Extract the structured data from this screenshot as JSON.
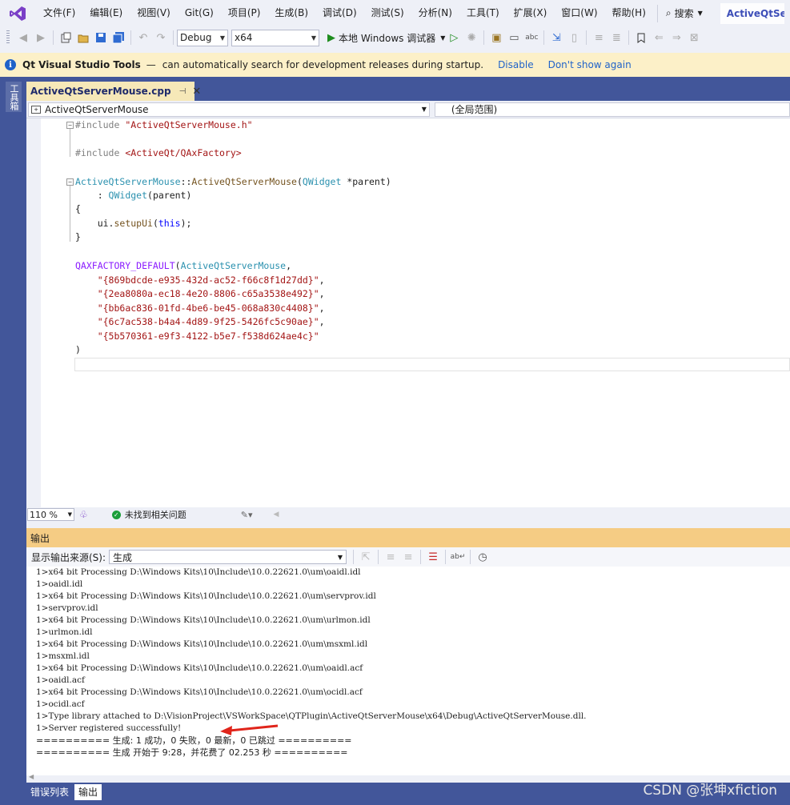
{
  "menu": {
    "items": [
      "文件(F)",
      "编辑(E)",
      "视图(V)",
      "Git(G)",
      "项目(P)",
      "生成(B)",
      "调试(D)",
      "测试(S)",
      "分析(N)",
      "工具(T)",
      "扩展(X)",
      "窗口(W)",
      "帮助(H)"
    ],
    "search_label": "搜索",
    "solution_name": "ActiveQtServerMouse"
  },
  "toolbar": {
    "configuration": "Debug",
    "platform": "x64",
    "run_label": "本地 Windows 调试器"
  },
  "infobar": {
    "title": "Qt Visual Studio Tools",
    "dash": "—",
    "message": "can automatically search for development releases during startup.",
    "link_disable": "Disable",
    "link_dont_show": "Don't show again"
  },
  "left_rail": {
    "toolbox_label": "工具箱"
  },
  "editor": {
    "tab_name": "ActiveQtServerMouse.cpp",
    "nav_class": "ActiveQtServerMouse",
    "nav_scope": "(全局范围)",
    "lines": [
      "#include \"ActiveQtServerMouse.h\"",
      "#include <ActiveQt/QAxFactory>",
      "ActiveQtServerMouse::ActiveQtServerMouse(QWidget *parent)",
      "    : QWidget(parent)",
      "{",
      "    ui.setupUi(this);",
      "}",
      "QAXFACTORY_DEFAULT(ActiveQtServerMouse,",
      "    \"{869bdcde-e935-432d-ac52-f66c8f1d27dd}\",",
      "    \"{2ea8080a-ec18-4e20-8806-c65a3538e492}\",",
      "    \"{bb6ac836-01fd-4be6-be45-068a830c4408}\",",
      "    \"{6c7ac538-b4a4-4d89-9f25-5426fc5c90ae}\",",
      "    \"{5b570361-e9f3-4122-b5e7-f538d624ae4c}\"",
      ")"
    ]
  },
  "editor_status": {
    "zoom": "110 %",
    "issues": "未找到相关问题"
  },
  "output": {
    "title": "输出",
    "source_label": "显示输出来源(S):",
    "source_value": "生成",
    "lines": [
      "1>x64 bit Processing D:\\Windows Kits\\10\\Include\\10.0.22621.0\\um\\oaidl.idl",
      "1>oaidl.idl",
      "1>x64 bit Processing D:\\Windows Kits\\10\\Include\\10.0.22621.0\\um\\servprov.idl",
      "1>servprov.idl",
      "1>x64 bit Processing D:\\Windows Kits\\10\\Include\\10.0.22621.0\\um\\urlmon.idl",
      "1>urlmon.idl",
      "1>x64 bit Processing D:\\Windows Kits\\10\\Include\\10.0.22621.0\\um\\msxml.idl",
      "1>msxml.idl",
      "1>x64 bit Processing D:\\Windows Kits\\10\\Include\\10.0.22621.0\\um\\oaidl.acf",
      "1>oaidl.acf",
      "1>x64 bit Processing D:\\Windows Kits\\10\\Include\\10.0.22621.0\\um\\ocidl.acf",
      "1>ocidl.acf",
      "1>Type library attached to D:\\VisionProject\\VSWorkSpace\\QTPlugin\\ActiveQtServerMouse\\x64\\Debug\\ActiveQtServerMouse.dll.",
      "1>Server registered successfully!",
      "========== 生成: 1 成功，0 失败，0 最新，0 已跳过 ==========",
      "========== 生成 开始于 9:28，并花费了 02.253 秒 =========="
    ]
  },
  "bottom_tabs": [
    "错误列表",
    "输出"
  ],
  "watermark": "CSDN @张坤xfiction"
}
